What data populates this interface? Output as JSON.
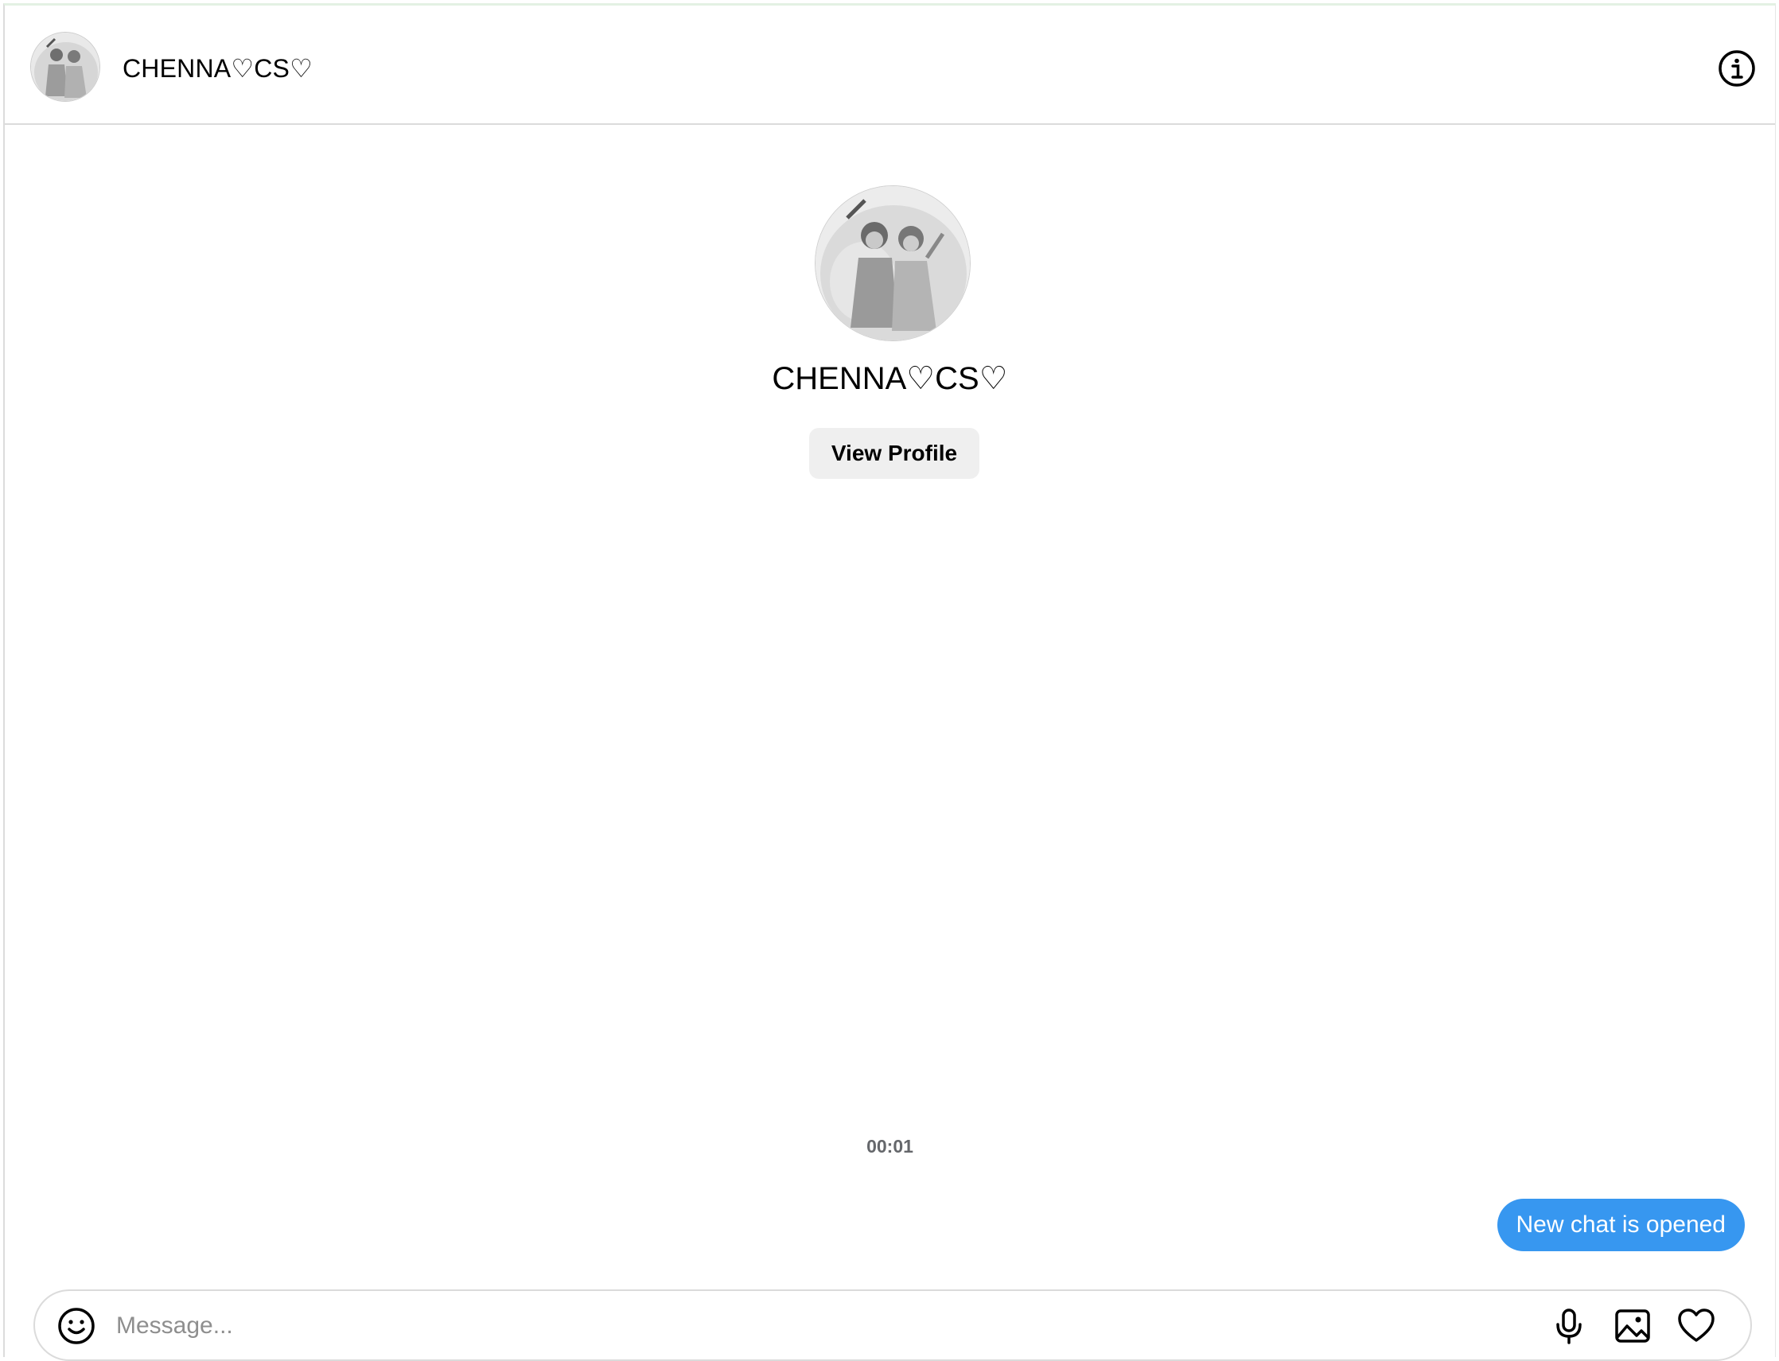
{
  "header": {
    "title": "CHENNA♡CS♡",
    "info_icon": "info-icon"
  },
  "profile": {
    "name": "CHENNA♡CS♡",
    "view_profile_label": "View Profile"
  },
  "thread": {
    "timestamp": "00:01",
    "messages": [
      {
        "text": "New chat is opened",
        "from": "me"
      }
    ]
  },
  "composer": {
    "placeholder": "Message...",
    "value": "",
    "icons": [
      "emoji-icon",
      "microphone-icon",
      "image-icon",
      "heart-icon"
    ]
  },
  "colors": {
    "accent": "#3797f0",
    "button_bg": "#efefef",
    "border": "#dbdbdb"
  }
}
